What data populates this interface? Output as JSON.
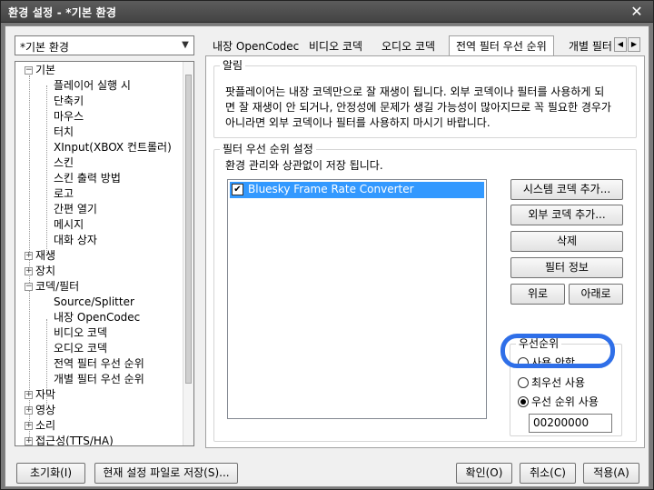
{
  "window": {
    "title": "환경 설정 - *기본 환경",
    "close_glyph": "✕"
  },
  "profile_combo": {
    "value": "*기본 환경"
  },
  "tree": {
    "items": [
      {
        "label": "기본",
        "toggle": "−"
      },
      {
        "label": "플레이어 실행 시"
      },
      {
        "label": "단축키"
      },
      {
        "label": "마우스"
      },
      {
        "label": "터치"
      },
      {
        "label": "XInput(XBOX 컨트롤러)"
      },
      {
        "label": "스킨"
      },
      {
        "label": "스킨 출력 방법"
      },
      {
        "label": "로고"
      },
      {
        "label": "간편 열기"
      },
      {
        "label": "메시지"
      },
      {
        "label": "대화 상자"
      },
      {
        "label": "재생",
        "toggle": "+"
      },
      {
        "label": "장치",
        "toggle": "+"
      },
      {
        "label": "코덱/필터",
        "toggle": "−"
      },
      {
        "label": "Source/Splitter"
      },
      {
        "label": "내장 OpenCodec"
      },
      {
        "label": "비디오 코덱"
      },
      {
        "label": "오디오 코덱"
      },
      {
        "label": "전역 필터 우선 순위"
      },
      {
        "label": "개별 필터 우선 순위"
      },
      {
        "label": "자막",
        "toggle": "+"
      },
      {
        "label": "영상",
        "toggle": "+"
      },
      {
        "label": "소리",
        "toggle": "+"
      },
      {
        "label": "접근성(TTS/HA)",
        "toggle": "+"
      }
    ]
  },
  "tabs": [
    {
      "label": "내장 OpenCodec"
    },
    {
      "label": "비디오 코덱"
    },
    {
      "label": "오디오 코덱"
    },
    {
      "label": "전역 필터 우선 순위"
    },
    {
      "label": "개별 필터"
    }
  ],
  "tab_scroll": {
    "left": "◀",
    "right": "▶"
  },
  "notice_group": {
    "title": "알림",
    "lines": [
      "팟플레이어는 내장 코덱만으로 잘 재생이 됩니다. 외부 코덱이나 필터를 사용하게 되",
      "면 잘 재생이 안 되거나, 안정성에 문제가 생길 가능성이 많아지므로 꼭 필요한 경우가",
      "아니라면 외부 코덱이나 필터를 사용하지 마시기 바랍니다."
    ]
  },
  "priority_group": {
    "title": "필터 우선 순위 설정",
    "subtitle": "환경 관리와 상관없이 저장 됩니다.",
    "list": [
      {
        "label": "Bluesky Frame Rate Converter",
        "checked": true,
        "check_glyph": "✔"
      }
    ],
    "buttons": {
      "add_system": "시스템 코덱 추가...",
      "add_external": "외부 코덱 추가...",
      "delete": "삭제",
      "filter_info": "필터 정보",
      "up": "위로",
      "down": "아래로"
    },
    "priority_box": {
      "title": "우선순위",
      "options": [
        {
          "label": "사용 안함",
          "selected": false
        },
        {
          "label": "최우선 사용",
          "selected": false
        },
        {
          "label": "우선 순위 사용",
          "selected": true
        }
      ],
      "value": "00200000"
    }
  },
  "bottom": {
    "reset": "초기화(I)",
    "save_current": "현재 설정 파일로 저장(S)...",
    "ok": "확인(O)",
    "cancel": "취소(C)",
    "apply": "적용(A)"
  },
  "colors": {
    "selection": "#3399ff",
    "annotation": "#2f6fe8"
  }
}
